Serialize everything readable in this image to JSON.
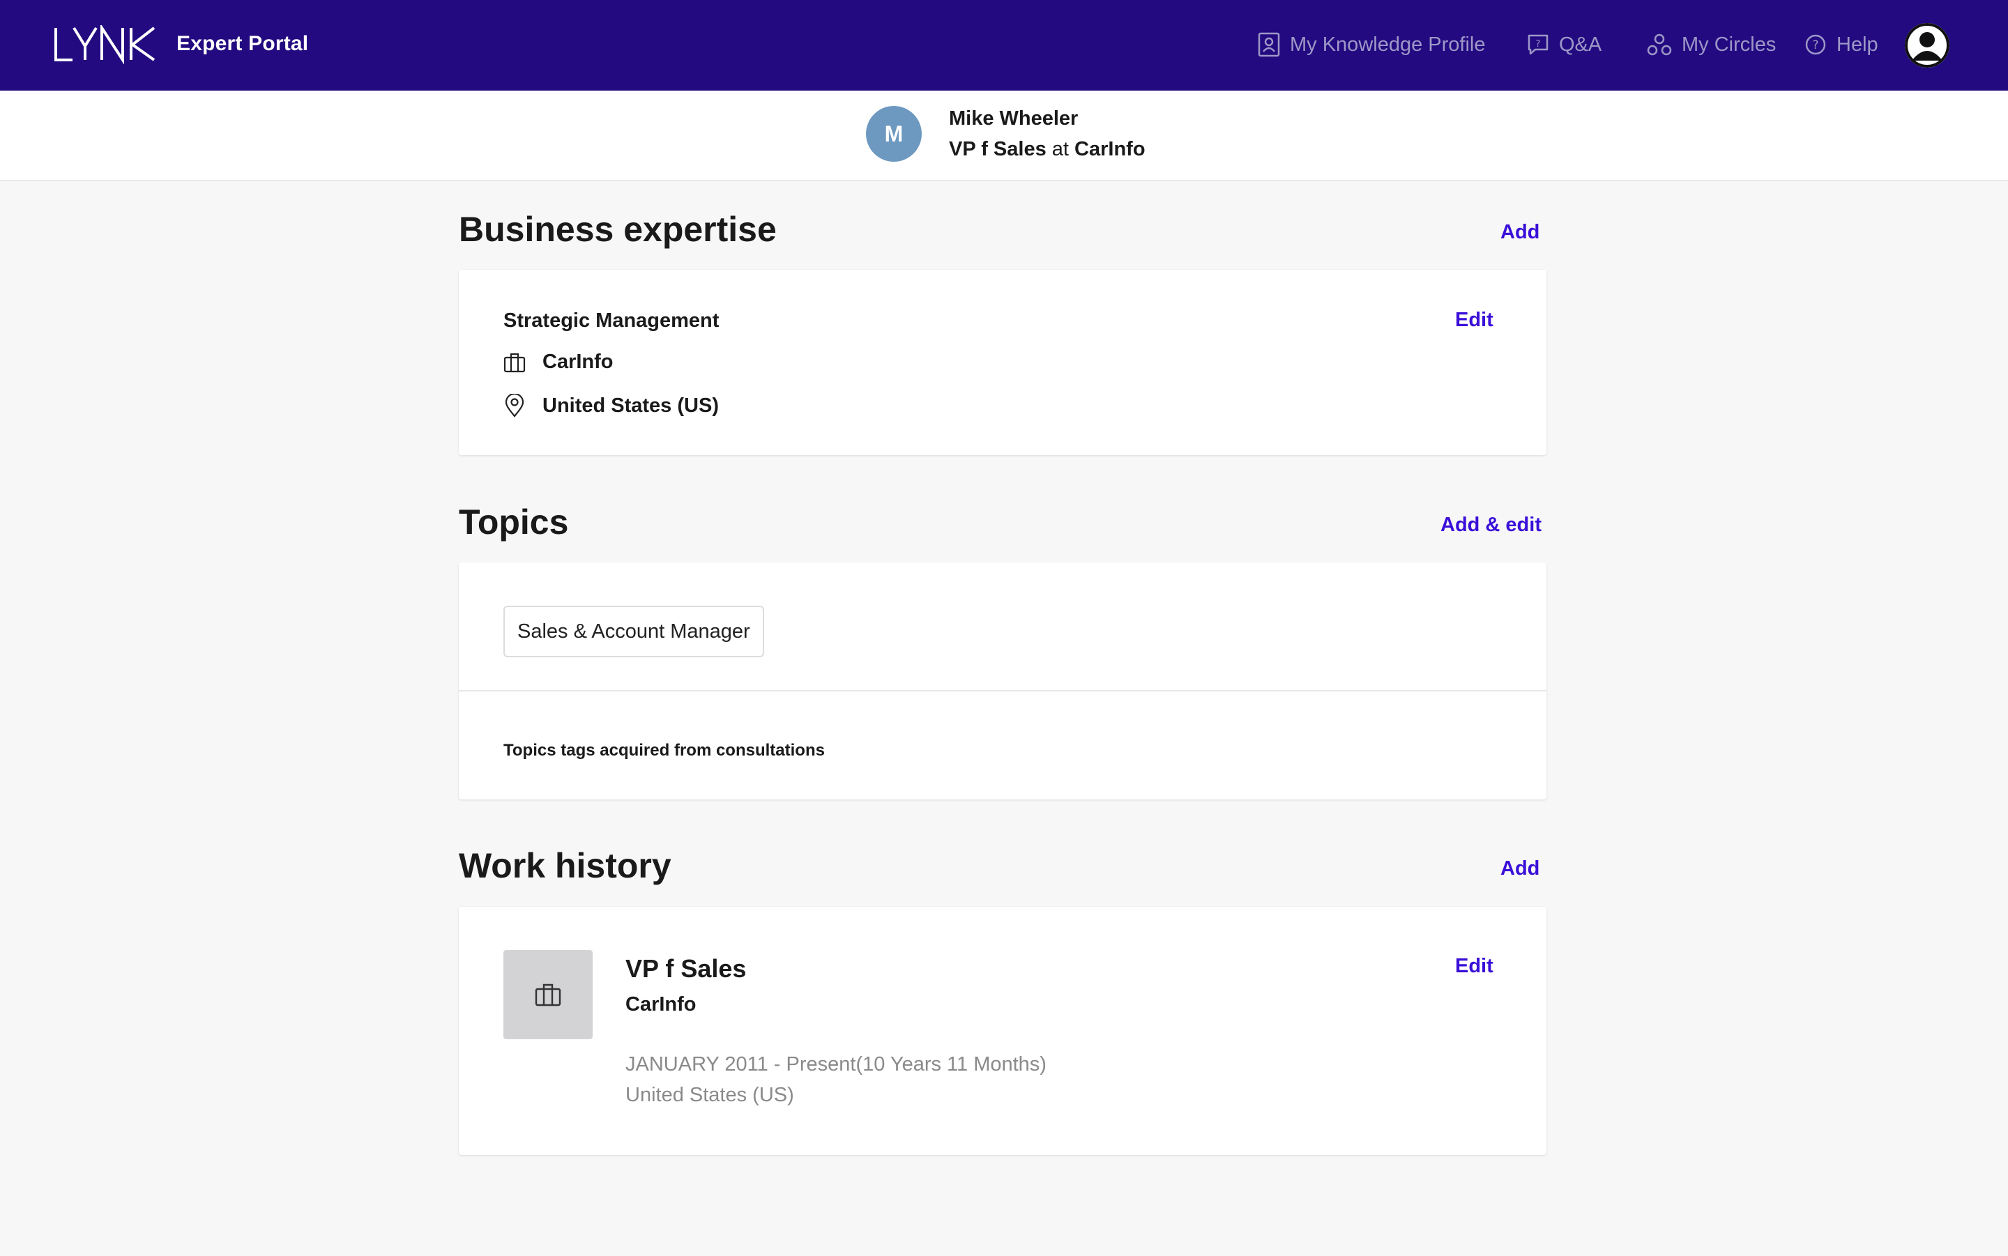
{
  "header": {
    "brand": "LYNK",
    "portal_title": "Expert Portal",
    "nav": [
      {
        "label": "My Knowledge Profile",
        "icon": "profile-card-icon"
      },
      {
        "label": "Q&A",
        "icon": "question-bubble-icon"
      },
      {
        "label": "My Circles",
        "icon": "circles-icon"
      },
      {
        "label": "Help",
        "icon": "help-circle-icon"
      }
    ],
    "account_icon": "user-avatar-icon"
  },
  "profile": {
    "initial": "M",
    "name": "Mike Wheeler",
    "title": "VP f Sales",
    "at": "at",
    "company": "CarInfo"
  },
  "business_expertise": {
    "heading": "Business expertise",
    "action": "Add",
    "item": {
      "label": "Strategic Management",
      "company": "CarInfo",
      "location": "United States (US)",
      "edit": "Edit"
    }
  },
  "topics": {
    "heading": "Topics",
    "action": "Add & edit",
    "chips": [
      "Sales & Account Manager"
    ],
    "note": "Topics tags acquired from consultations"
  },
  "work_history": {
    "heading": "Work history",
    "action": "Add",
    "job": {
      "title": "VP f Sales",
      "company": "CarInfo",
      "dates": "JANUARY 2011 - Present(10 Years 11 Months)",
      "location": "United States (US)",
      "edit": "Edit"
    }
  },
  "colors": {
    "nav_bg": "#230a80",
    "accent": "#3a0fd9",
    "avatar": "#6d98c0"
  }
}
